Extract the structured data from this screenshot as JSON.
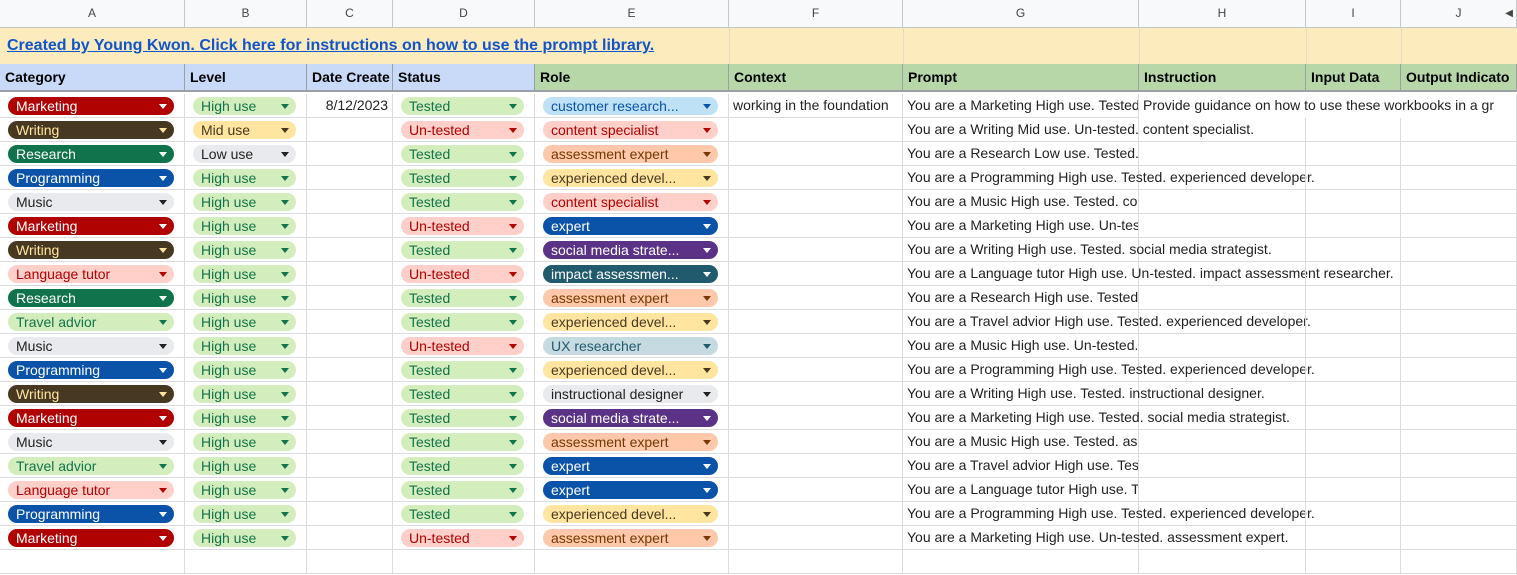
{
  "columns": [
    "A",
    "B",
    "C",
    "D",
    "E",
    "F",
    "G",
    "H",
    "I",
    "J"
  ],
  "banner": {
    "link_text": "Created by Young Kwon. Click here for instructions on how to use the prompt library."
  },
  "headers": [
    "Category",
    "Level",
    "Date Create",
    "Status",
    "Role",
    "Context",
    "Prompt",
    "Instruction",
    "Input Data",
    "Output Indicato"
  ],
  "colors": {
    "Marketing": {
      "bg": "#b10202",
      "fg": "#ffffff"
    },
    "Writing": {
      "bg": "#473822",
      "fg": "#ffe5a0"
    },
    "Research": {
      "bg": "#11734b",
      "fg": "#ffffff"
    },
    "Programming": {
      "bg": "#0a53a8",
      "fg": "#ffffff"
    },
    "Music": {
      "bg": "#e8eaed",
      "fg": "#222222"
    },
    "Language tutor": {
      "bg": "#ffcfc9",
      "fg": "#b10202"
    },
    "Travel advior": {
      "bg": "#d4edbc",
      "fg": "#11734b"
    },
    "High use": {
      "bg": "#d4edbc",
      "fg": "#11734b"
    },
    "Mid use": {
      "bg": "#ffe5a0",
      "fg": "#473822"
    },
    "Low use": {
      "bg": "#e8eaed",
      "fg": "#222222"
    },
    "Tested": {
      "bg": "#d4edbc",
      "fg": "#11734b"
    },
    "Un-tested": {
      "bg": "#ffcfc9",
      "fg": "#b10202"
    },
    "customer research...": {
      "bg": "#bfe1f6",
      "fg": "#0a53a8"
    },
    "content specialist": {
      "bg": "#ffcfc9",
      "fg": "#b10202"
    },
    "assessment expert": {
      "bg": "#ffc8aa",
      "fg": "#753800"
    },
    "experienced devel...": {
      "bg": "#ffe5a0",
      "fg": "#473822"
    },
    "expert": {
      "bg": "#0a53a8",
      "fg": "#ffffff"
    },
    "social media strate...": {
      "bg": "#5a3286",
      "fg": "#ffffff"
    },
    "impact assessmen...": {
      "bg": "#215a6c",
      "fg": "#ffffff"
    },
    "UX researcher": {
      "bg": "#c6dbe1",
      "fg": "#215a6c"
    },
    "instructional designer": {
      "bg": "#e8eaed",
      "fg": "#222222"
    }
  },
  "rows": [
    {
      "category": "Marketing",
      "level": "High use",
      "date": "8/12/2023",
      "status": "Tested",
      "role": "customer research...",
      "context": "working in the foundation",
      "prompt": "You are a Marketing High use. Tested",
      "instruction": "Provide guidance on how to use these workbooks in a gr"
    },
    {
      "category": "Writing",
      "level": "Mid use",
      "date": "",
      "status": "Un-tested",
      "role": "content specialist",
      "context": "",
      "prompt": "You are a Writing Mid use. Un-tested. content specialist.",
      "instruction": ""
    },
    {
      "category": "Research",
      "level": "Low use",
      "date": "",
      "status": "Tested",
      "role": "assessment expert",
      "context": "",
      "prompt": "You are a Research Low use. Tested. assessment expert.",
      "instruction": ""
    },
    {
      "category": "Programming",
      "level": "High use",
      "date": "",
      "status": "Tested",
      "role": "experienced devel...",
      "context": "",
      "prompt": "You are a Programming High use. Tested. experienced developer.",
      "instruction": ""
    },
    {
      "category": "Music",
      "level": "High use",
      "date": "",
      "status": "Tested",
      "role": "content specialist",
      "context": "",
      "prompt": "You are a Music High use. Tested. content specialist.",
      "instruction": ""
    },
    {
      "category": "Marketing",
      "level": "High use",
      "date": "",
      "status": "Un-tested",
      "role": "expert",
      "context": "",
      "prompt": "You are a Marketing High use. Un-tested. expert.",
      "instruction": ""
    },
    {
      "category": "Writing",
      "level": "High use",
      "date": "",
      "status": "Tested",
      "role": "social media strate...",
      "context": "",
      "prompt": "You are a Writing High use. Tested. social media strategist.",
      "instruction": ""
    },
    {
      "category": "Language tutor",
      "level": "High use",
      "date": "",
      "status": "Un-tested",
      "role": "impact assessmen...",
      "context": "",
      "prompt": "You are a Language tutor High use. Un-tested. impact assessment researcher.",
      "instruction": ""
    },
    {
      "category": "Research",
      "level": "High use",
      "date": "",
      "status": "Tested",
      "role": "assessment expert",
      "context": "",
      "prompt": "You are a Research High use. Tested. assessment expert.",
      "instruction": ""
    },
    {
      "category": "Travel advior",
      "level": "High use",
      "date": "",
      "status": "Tested",
      "role": "experienced devel...",
      "context": "",
      "prompt": "You are a Travel advior High use. Tested. experienced developer.",
      "instruction": ""
    },
    {
      "category": "Music",
      "level": "High use",
      "date": "",
      "status": "Un-tested",
      "role": "UX researcher",
      "context": "",
      "prompt": "You are a Music High use. Un-tested. UX researcher.",
      "instruction": ""
    },
    {
      "category": "Programming",
      "level": "High use",
      "date": "",
      "status": "Tested",
      "role": "experienced devel...",
      "context": "",
      "prompt": "You are a Programming High use. Tested. experienced developer.",
      "instruction": ""
    },
    {
      "category": "Writing",
      "level": "High use",
      "date": "",
      "status": "Tested",
      "role": "instructional designer",
      "context": "",
      "prompt": "You are a Writing High use. Tested. instructional designer.",
      "instruction": ""
    },
    {
      "category": "Marketing",
      "level": "High use",
      "date": "",
      "status": "Tested",
      "role": "social media strate...",
      "context": "",
      "prompt": "You are a Marketing High use. Tested. social media strategist.",
      "instruction": ""
    },
    {
      "category": "Music",
      "level": "High use",
      "date": "",
      "status": "Tested",
      "role": "assessment expert",
      "context": "",
      "prompt": "You are a Music High use. Tested. assessment expert.",
      "instruction": ""
    },
    {
      "category": "Travel advior",
      "level": "High use",
      "date": "",
      "status": "Tested",
      "role": "expert",
      "context": "",
      "prompt": "You are a Travel advior High use. Tested. expert.",
      "instruction": ""
    },
    {
      "category": "Language tutor",
      "level": "High use",
      "date": "",
      "status": "Tested",
      "role": "expert",
      "context": "",
      "prompt": "You are a Language tutor High use. Tested. expert.",
      "instruction": ""
    },
    {
      "category": "Programming",
      "level": "High use",
      "date": "",
      "status": "Tested",
      "role": "experienced devel...",
      "context": "",
      "prompt": "You are a Programming High use. Tested. experienced developer.",
      "instruction": ""
    },
    {
      "category": "Marketing",
      "level": "High use",
      "date": "",
      "status": "Un-tested",
      "role": "assessment expert",
      "context": "",
      "prompt": "You are a Marketing High use. Un-tested. assessment expert.",
      "instruction": ""
    }
  ]
}
